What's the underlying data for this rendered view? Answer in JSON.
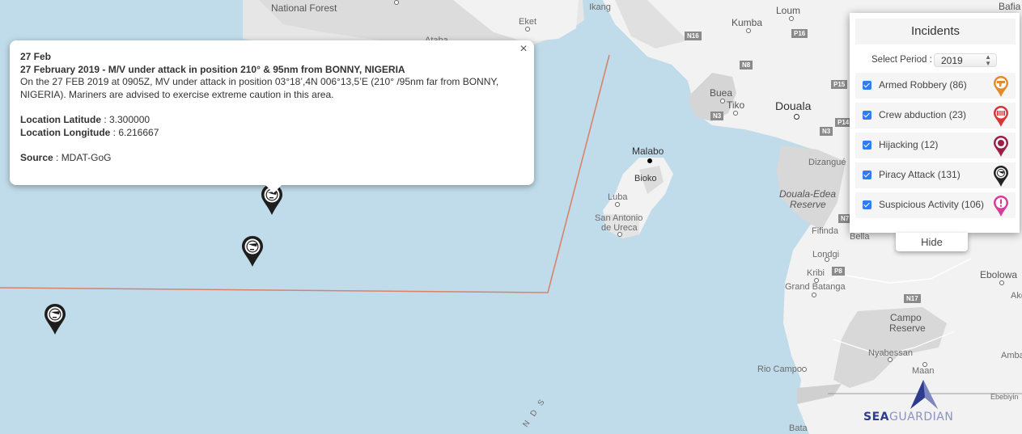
{
  "map": {
    "places": {
      "national_forest": "National Forest",
      "eket": "Eket",
      "ikang": "Ikang",
      "ataba": "Ataba",
      "kumba": "Kumba",
      "loum": "Loum",
      "bafia": "Bafia",
      "buea": "Buea",
      "tiko": "Tiko",
      "douala": "Douala",
      "malabo": "Malabo",
      "bioko": "Bioko",
      "luba": "Luba",
      "san_antonio_1": "San Antonio",
      "san_antonio_2": "de Ureca",
      "dizangue": "Dizangué",
      "douala_edea_1": "Douala-Edea",
      "douala_edea_2": "Reserve",
      "fifinda": "Fifinda",
      "bella": "Bella",
      "londgi": "Londgi",
      "kribi": "Kribi",
      "grand_batanga": "Grand Batanga",
      "ebolowa": "Ebolowa",
      "ako": "Ako",
      "campo_1": "Campo",
      "campo_2": "Reserve",
      "nyabessan": "Nyabessan",
      "maan": "Maan",
      "rio_campo": "Rio Campo",
      "ambam": "Amba",
      "ebebiyin": "Ebebiyin",
      "bata": "Bata",
      "islands_fragment": "N D S"
    },
    "roads": [
      "N16",
      "P16",
      "N8",
      "N3",
      "P15",
      "P14",
      "N3",
      "N7",
      "P8",
      "N17"
    ]
  },
  "popup": {
    "close_icon": "×",
    "date_short": "27 Feb",
    "headline": "27 February 2019 - M/V under attack in position 210° & 95nm from BONNY, NIGERIA",
    "description": "On the 27 FEB 2019 at 0905Z, MV under attack in position 03°18’,4N 006°13,5’E (210° /95nm far from BONNY, NIGERIA). Mariners are advised to exercise extreme caution in this area.",
    "lat_label": "Location Latitude",
    "lat_value": " : 3.300000",
    "lon_label": "Location Longitude",
    "lon_value": " : 6.216667",
    "source_label": "Source",
    "source_value": " : MDAT-GoG"
  },
  "markers": [
    {
      "type": "piracy-attack"
    },
    {
      "type": "piracy-attack"
    },
    {
      "type": "piracy-attack"
    }
  ],
  "panel": {
    "title": "Incidents",
    "period_label": "Select Period :",
    "period_value": "2019",
    "items": [
      {
        "label": "Armed Robbery (86)",
        "checked": true,
        "icon": "armed-robbery-icon",
        "color": "#e58a2b"
      },
      {
        "label": "Crew abduction (23)",
        "checked": true,
        "icon": "crew-abduction-icon",
        "color": "#d9343a"
      },
      {
        "label": "Hijacking (12)",
        "checked": true,
        "icon": "hijacking-icon",
        "color": "#9c1f45"
      },
      {
        "label": "Piracy Attack (131)",
        "checked": true,
        "icon": "piracy-attack-icon",
        "color": "#222222"
      },
      {
        "label": "Suspicious Activity (106)",
        "checked": true,
        "icon": "suspicious-activity-icon",
        "color": "#d63c99"
      }
    ],
    "hide_label": "Hide"
  },
  "logo": {
    "part1": "SEA",
    "part2": "GUARDIAN"
  }
}
